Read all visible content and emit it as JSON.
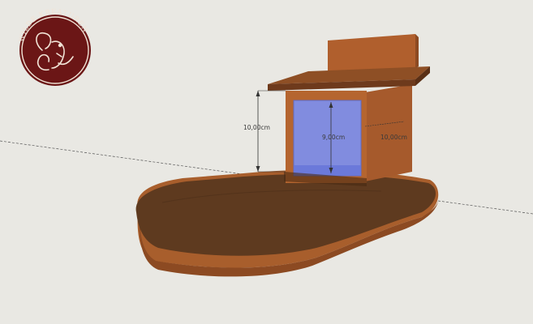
{
  "logo": {
    "text": "WILDE KREATUREN",
    "icon": "squirrel-icon",
    "colors": {
      "badge": "#6b1616",
      "ring": "#f1e3d6"
    }
  },
  "dimensions": {
    "height_label": "10,00cm",
    "inner_width_label": "9,00cm",
    "depth_label": "10,00cm"
  },
  "colors": {
    "background": "#e9e8e3",
    "wood": "#a65a2c",
    "wood_dark": "#5e3a1f",
    "glass": "#7f8fe9"
  }
}
